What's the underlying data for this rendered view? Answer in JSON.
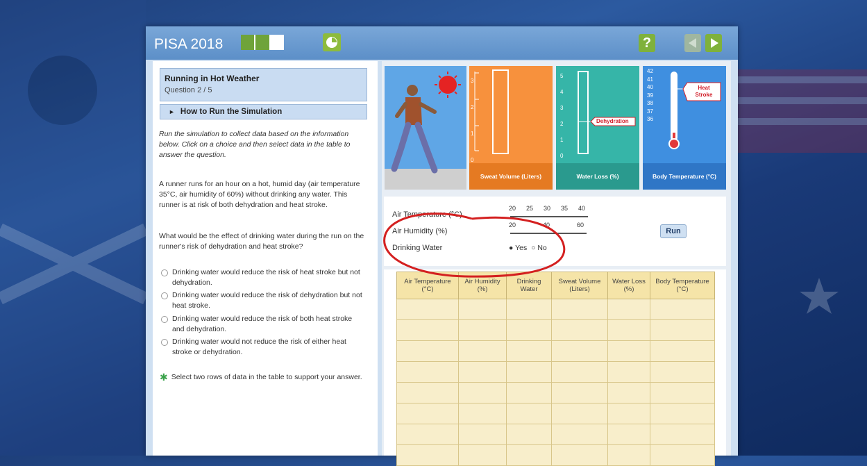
{
  "header": {
    "brand": "PISA 2018",
    "help_label": "?",
    "progress_segments": [
      "done",
      "done",
      "current"
    ]
  },
  "question": {
    "title": "Running in Hot Weather",
    "number": "Question 2 / 5",
    "howto_label": "How to Run the Simulation",
    "instructions": "Run the simulation to collect data based on the information below. Click on a choice and then select data in the table to answer the question.",
    "scenario": "A runner runs for an hour on a hot, humid day (air temperature 35°C, air humidity of 60%) without drinking any water. This runner is at risk of both dehydration and heat stroke.",
    "prompt": "What would be the effect of drinking water during the run on the runner's risk of dehydration and heat stroke?",
    "options": [
      "Drinking water would reduce the risk of heat stroke but not dehydration.",
      "Drinking water would reduce the risk of dehydration but not heat stroke.",
      "Drinking water would reduce the risk of both heat stroke and dehydration.",
      "Drinking water would not reduce the risk of either heat stroke or dehydration."
    ],
    "hint": "Select two rows of data in the table to support your answer."
  },
  "gauges": {
    "sweat": {
      "label": "Sweat Volume (Liters)",
      "ticks": [
        "3",
        "2",
        "1",
        "0"
      ],
      "color": "#f7913d"
    },
    "water": {
      "label": "Water Loss (%)",
      "ticks": [
        "5",
        "4",
        "3",
        "2",
        "1",
        "0"
      ],
      "color": "#36b5a8",
      "callout": "Dehydration"
    },
    "body": {
      "label": "Body Temperature (°C)",
      "ticks": [
        "42",
        "41",
        "40",
        "39",
        "38",
        "37",
        "36"
      ],
      "color": "#3f8fe0",
      "callout": "Heat Stroke"
    }
  },
  "controls": {
    "air_temp": {
      "label": "Air Temperature (°C)",
      "ticks": [
        "20",
        "25",
        "30",
        "35",
        "40"
      ]
    },
    "air_humidity": {
      "label": "Air Humidity (%)",
      "ticks": [
        "20",
        "40",
        "60"
      ]
    },
    "drinking": {
      "label": "Drinking Water",
      "yes": "Yes",
      "no": "No",
      "selected": "Yes"
    },
    "run_label": "Run"
  },
  "table": {
    "headers": [
      "Air Temperature (°C)",
      "Air Humidity (%)",
      "Drinking Water",
      "Sweat Volume (Liters)",
      "Water Loss (%)",
      "Body Temperature (°C)"
    ],
    "rows": [
      [
        "",
        "",
        "",
        "",
        "",
        ""
      ],
      [
        "",
        "",
        "",
        "",
        "",
        ""
      ],
      [
        "",
        "",
        "",
        "",
        "",
        ""
      ],
      [
        "",
        "",
        "",
        "",
        "",
        ""
      ],
      [
        "",
        "",
        "",
        "",
        "",
        ""
      ],
      [
        "",
        "",
        "",
        "",
        "",
        ""
      ],
      [
        "",
        "",
        "",
        "",
        "",
        ""
      ],
      [
        "",
        "",
        "",
        "",
        "",
        ""
      ]
    ]
  },
  "colors": {
    "accent_green": "#7fb13b",
    "annotation_red": "#d42020",
    "table_header": "#f5e4a8"
  }
}
